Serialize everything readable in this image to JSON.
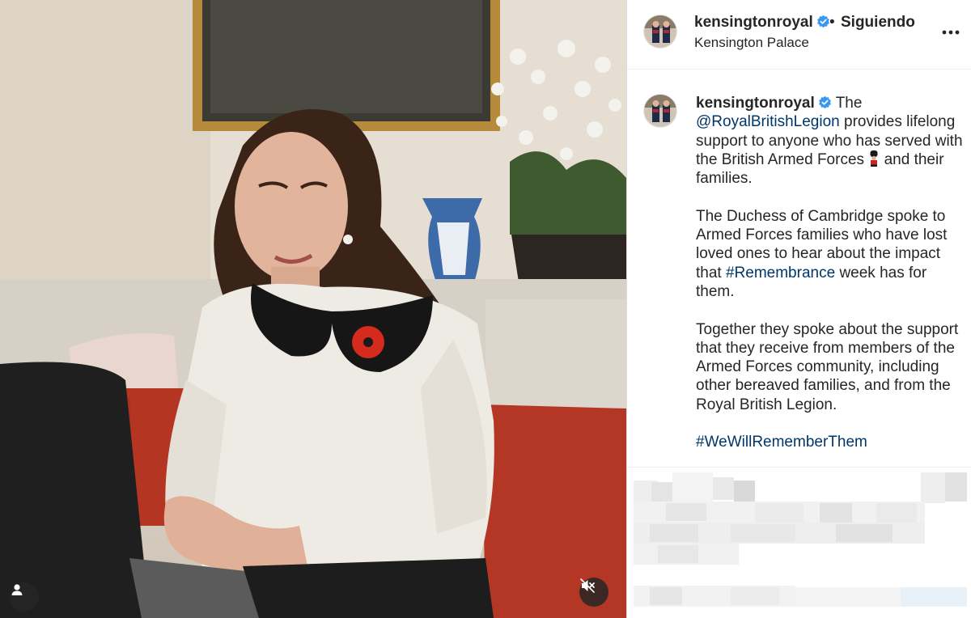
{
  "post": {
    "author": {
      "username": "kensingtonroyal",
      "verified": true,
      "follow_status": "Siguiendo",
      "separator": "•",
      "location": "Kensington Palace"
    },
    "caption": {
      "username": "kensingtonroyal",
      "p1_before": "The",
      "mention": "@RoyalBritishLegion",
      "p1_middle": "provides lifelong support to anyone who has served with the British Armed Forces",
      "p1_after": "and their families.",
      "p2_before": "The Duchess of Cambridge spoke to Armed Forces families who have lost loved ones to hear about the impact that",
      "p2_hashtag": "#Remembrance",
      "p2_after": "week has for them.",
      "p3": "Together they spoke about the support that they receive from members of the Armed Forces community, including other bereaved families, and from the Royal British Legion.",
      "hashtag": "#WeWillRememberThem"
    },
    "media": {
      "type": "video",
      "muted": true
    }
  },
  "icons": {
    "verified": "verified-badge-icon",
    "more": "more-options-icon",
    "user_tag": "user-tag-icon",
    "mute": "speaker-muted-icon",
    "soldier": "guardsman-emoji"
  },
  "colors": {
    "link": "#00376b",
    "verified": "#3897f0",
    "text": "#262626"
  }
}
